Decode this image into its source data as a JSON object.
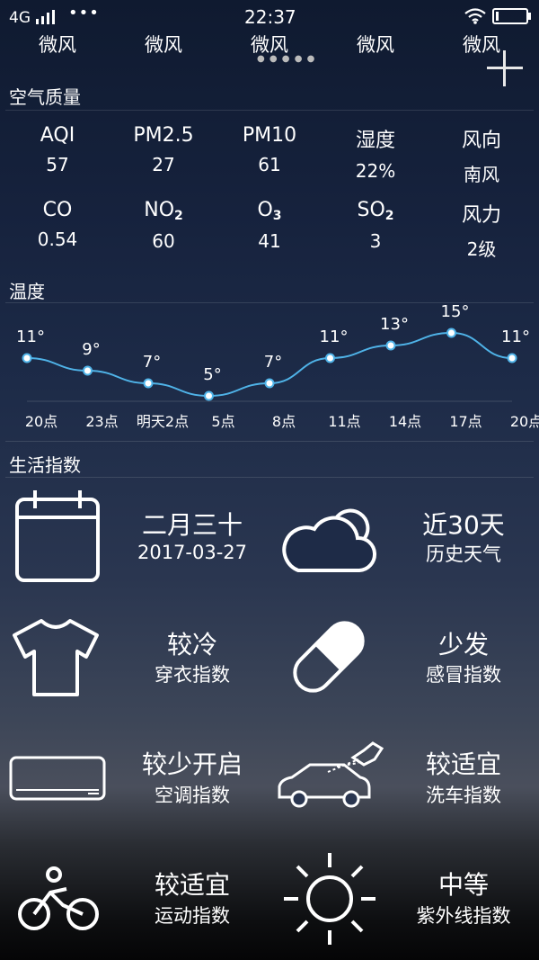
{
  "status_bar": {
    "network": "4G",
    "dots": "•••",
    "time": "22:37"
  },
  "wind_row": [
    "微风",
    "微风",
    "微风",
    "微风",
    "微风"
  ],
  "air_quality": {
    "title": "空气质量",
    "row1": [
      {
        "label": "AQI",
        "value": "57"
      },
      {
        "label": "PM2.5",
        "value": "27"
      },
      {
        "label": "PM10",
        "value": "61"
      },
      {
        "label": "湿度",
        "value": "22%"
      },
      {
        "label": "风向",
        "value": "南风"
      }
    ],
    "row2": [
      {
        "label": "CO",
        "sub": "",
        "value": "0.54"
      },
      {
        "label": "NO",
        "sub": "2",
        "value": "60"
      },
      {
        "label": "O",
        "sub": "3",
        "value": "41"
      },
      {
        "label": "SO",
        "sub": "2",
        "value": "3"
      },
      {
        "label": "风力",
        "sub": "",
        "value": "2级"
      }
    ]
  },
  "temperature": {
    "title": "温度",
    "temps": [
      "11°",
      "9°",
      "7°",
      "5°",
      "7°",
      "11°",
      "13°",
      "15°",
      "11°"
    ],
    "temp_values": [
      11,
      9,
      7,
      5,
      7,
      11,
      13,
      15,
      11
    ],
    "hours": [
      "20点",
      "23点",
      "明天2点",
      "5点",
      "8点",
      "11点",
      "14点",
      "17点",
      "20点"
    ]
  },
  "life_index": {
    "title": "生活指数",
    "items": [
      {
        "main": "二月三十",
        "sub": "2017-03-27",
        "icon": "calendar-icon"
      },
      {
        "main": "近30天",
        "sub": "历史天气",
        "icon": "cloud-sun-icon"
      },
      {
        "main": "较冷",
        "sub": "穿衣指数",
        "icon": "tshirt-icon"
      },
      {
        "main": "少发",
        "sub": "感冒指数",
        "icon": "pill-icon"
      },
      {
        "main": "较少开启",
        "sub": "空调指数",
        "icon": "air-conditioner-icon"
      },
      {
        "main": "较适宜",
        "sub": "洗车指数",
        "icon": "car-wash-icon"
      },
      {
        "main": "较适宜",
        "sub": "运动指数",
        "icon": "bicycle-icon"
      },
      {
        "main": "中等",
        "sub": "紫外线指数",
        "icon": "sun-icon"
      }
    ]
  }
}
